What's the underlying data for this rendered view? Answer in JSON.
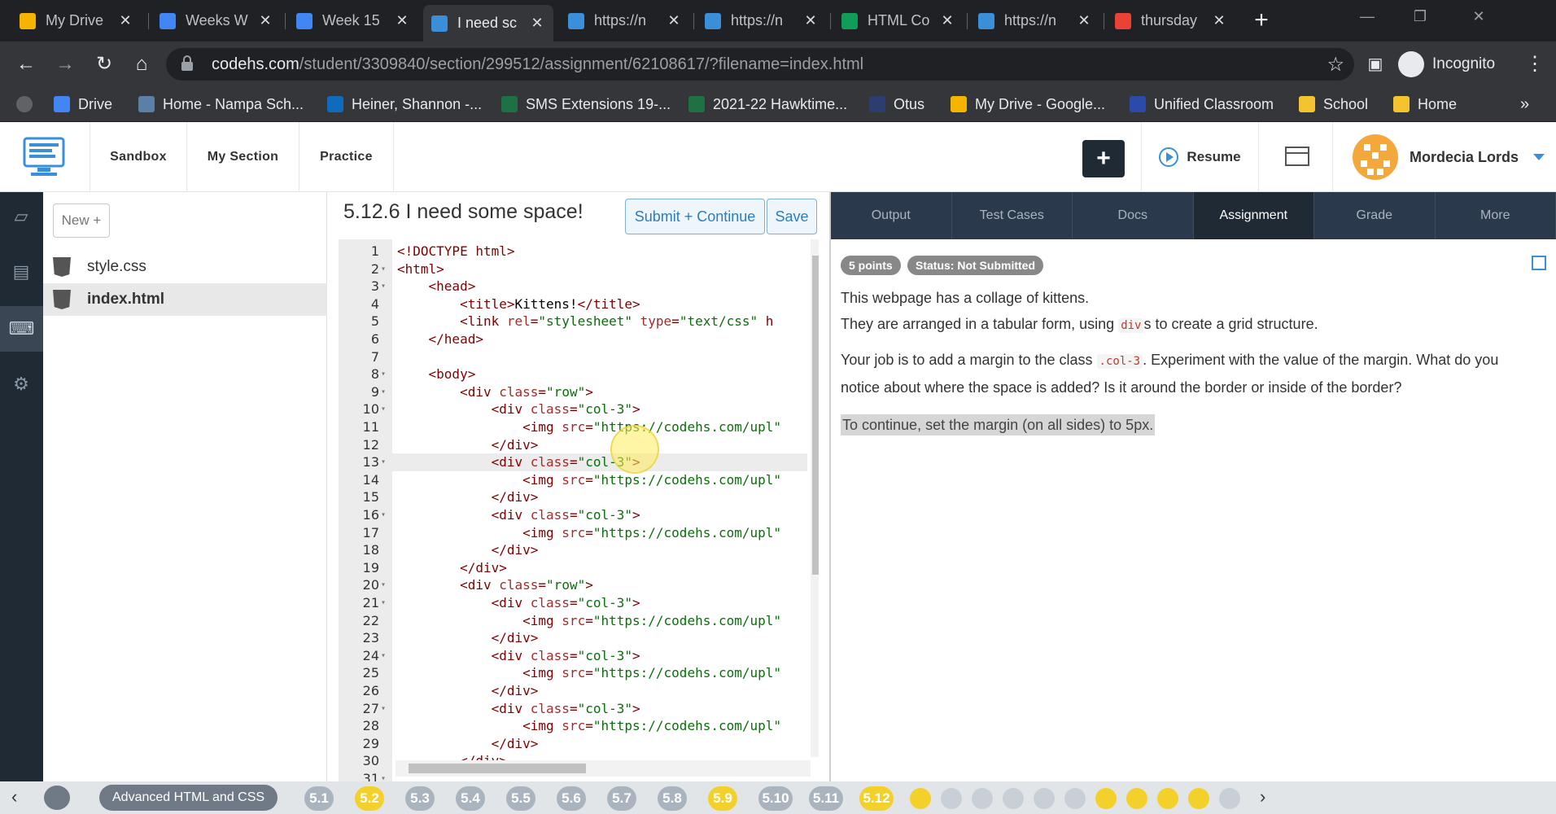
{
  "browser": {
    "tabs": [
      {
        "title": "My Drive",
        "color": "#f4b400"
      },
      {
        "title": "Weeks W",
        "color": "#4285f4"
      },
      {
        "title": "Week 15",
        "color": "#4285f4"
      },
      {
        "title": "I need sc",
        "color": "#3a8fd8"
      },
      {
        "title": "https://n",
        "color": "#3a8fd8"
      },
      {
        "title": "https://n",
        "color": "#3a8fd8"
      },
      {
        "title": "HTML Co",
        "color": "#0f9d58"
      },
      {
        "title": "https://n",
        "color": "#3a8fd8"
      },
      {
        "title": "thursday",
        "color": "#ea4335"
      }
    ],
    "url_host": "codehs.com",
    "url_path": "/student/3309840/section/299512/assignment/62108617/?filename=index.html",
    "incognito_label": "Incognito",
    "bookmarks": [
      {
        "label": "Drive",
        "color": "#4285f4"
      },
      {
        "label": "Home - Nampa Sch...",
        "color": "#5b7fa6"
      },
      {
        "label": "Heiner, Shannon -...",
        "color": "#0f6cbd"
      },
      {
        "label": "SMS Extensions 19-...",
        "color": "#1e7145"
      },
      {
        "label": "2021-22 Hawktime...",
        "color": "#1e7145"
      },
      {
        "label": "Otus",
        "color": "#2c3e70"
      },
      {
        "label": "My Drive - Google...",
        "color": "#f4b400"
      },
      {
        "label": "Unified Classroom",
        "color": "#2c4aa8"
      },
      {
        "label": "School",
        "color": "#f4c430"
      },
      {
        "label": "Home",
        "color": "#f4c430"
      }
    ]
  },
  "header": {
    "nav": [
      "Sandbox",
      "My Section",
      "Practice"
    ],
    "plus_label": "+",
    "resume_label": "Resume",
    "user_name": "Mordecia Lords"
  },
  "files": {
    "new_label": "New +",
    "items": [
      {
        "name": "style.css",
        "selected": false
      },
      {
        "name": "index.html",
        "selected": true
      }
    ]
  },
  "editor": {
    "title": "5.12.6 I need some space!",
    "submit_label": "Submit + Continue",
    "save_label": "Save",
    "current_line": 13,
    "lines": [
      {
        "n": "1",
        "fold": "",
        "code": "<!DOCTYPE html>"
      },
      {
        "n": "2",
        "fold": "▾",
        "code": "<html>"
      },
      {
        "n": "3",
        "fold": "▾",
        "code": "    <head>"
      },
      {
        "n": "4",
        "fold": "",
        "code": "        <title>Kittens!</title>"
      },
      {
        "n": "5",
        "fold": "",
        "code": "        <link rel=\"stylesheet\" type=\"text/css\" h"
      },
      {
        "n": "6",
        "fold": "",
        "code": "    </head>"
      },
      {
        "n": "7",
        "fold": "",
        "code": ""
      },
      {
        "n": "8",
        "fold": "▾",
        "code": "    <body>"
      },
      {
        "n": "9",
        "fold": "▾",
        "code": "        <div class=\"row\">"
      },
      {
        "n": "10",
        "fold": "▾",
        "code": "            <div class=\"col-3\">"
      },
      {
        "n": "11",
        "fold": "",
        "code": "                <img src=\"https://codehs.com/upl"
      },
      {
        "n": "12",
        "fold": "",
        "code": "            </div>"
      },
      {
        "n": "13",
        "fold": "▾",
        "code": "            <div class=\"col-3\">"
      },
      {
        "n": "14",
        "fold": "",
        "code": "                <img src=\"https://codehs.com/upl"
      },
      {
        "n": "15",
        "fold": "",
        "code": "            </div>"
      },
      {
        "n": "16",
        "fold": "▾",
        "code": "            <div class=\"col-3\">"
      },
      {
        "n": "17",
        "fold": "",
        "code": "                <img src=\"https://codehs.com/upl"
      },
      {
        "n": "18",
        "fold": "",
        "code": "            </div>"
      },
      {
        "n": "19",
        "fold": "",
        "code": "        </div>"
      },
      {
        "n": "20",
        "fold": "▾",
        "code": "        <div class=\"row\">"
      },
      {
        "n": "21",
        "fold": "▾",
        "code": "            <div class=\"col-3\">"
      },
      {
        "n": "22",
        "fold": "",
        "code": "                <img src=\"https://codehs.com/upl"
      },
      {
        "n": "23",
        "fold": "",
        "code": "            </div>"
      },
      {
        "n": "24",
        "fold": "▾",
        "code": "            <div class=\"col-3\">"
      },
      {
        "n": "25",
        "fold": "",
        "code": "                <img src=\"https://codehs.com/upl"
      },
      {
        "n": "26",
        "fold": "",
        "code": "            </div>"
      },
      {
        "n": "27",
        "fold": "▾",
        "code": "            <div class=\"col-3\">"
      },
      {
        "n": "28",
        "fold": "",
        "code": "                <img src=\"https://codehs.com/upl"
      },
      {
        "n": "29",
        "fold": "",
        "code": "            </div>"
      },
      {
        "n": "30",
        "fold": "",
        "code": "        </div>"
      },
      {
        "n": "31",
        "fold": "▾",
        "code": ""
      }
    ]
  },
  "right": {
    "tabs": [
      "Output",
      "Test Cases",
      "Docs",
      "Assignment",
      "Grade",
      "More"
    ],
    "active_tab": "Assignment",
    "points_badge": "5 points",
    "status_badge": "Status: Not Submitted",
    "p1": "This webpage has a collage of kittens.",
    "p2_pre": "They are arranged in a tabular form, using ",
    "p2_code": "div",
    "p2_post": "s to create a grid structure.",
    "p3_pre": "Your job is to add a margin to the class ",
    "p3_code": ".col-3",
    "p3_post": ". Experiment with the value of the margin. What do you notice about where the space is added? Is it around the border or inside of the border?",
    "p4": "To continue, set the margin (on all sides) to 5px."
  },
  "bottom": {
    "course_label": "Advanced HTML and CSS",
    "lessons": [
      {
        "label": "5.1",
        "done": false
      },
      {
        "label": "5.2",
        "done": true
      },
      {
        "label": "5.3",
        "done": false
      },
      {
        "label": "5.4",
        "done": false
      },
      {
        "label": "5.5",
        "done": false
      },
      {
        "label": "5.6",
        "done": false
      },
      {
        "label": "5.7",
        "done": false
      },
      {
        "label": "5.8",
        "done": false
      },
      {
        "label": "5.9",
        "done": true
      },
      {
        "label": "5.10",
        "done": false
      },
      {
        "label": "5.11",
        "done": false
      },
      {
        "label": "5.12",
        "done": true
      }
    ]
  }
}
